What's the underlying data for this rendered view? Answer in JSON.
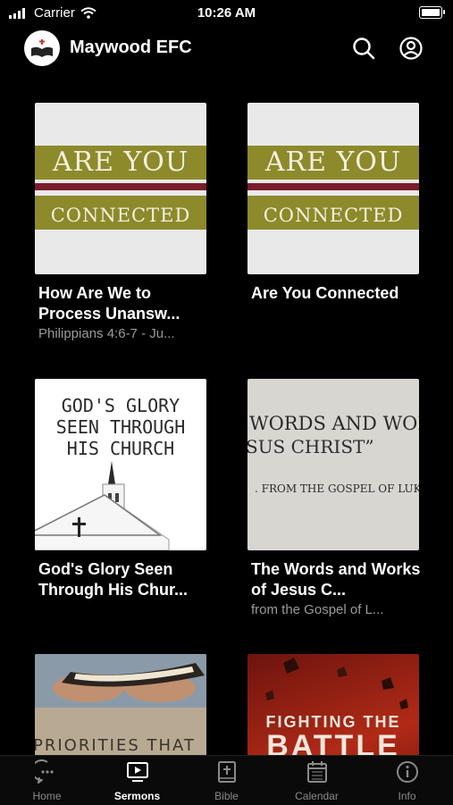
{
  "status_bar": {
    "carrier": "Carrier",
    "time": "10:26 AM"
  },
  "header": {
    "title": "Maywood EFC",
    "logo_icon": "church-bible-logo-icon"
  },
  "sermons": [
    {
      "title": "How Are We to Process Unansw...",
      "subtitle": "Philippians 4:6-7 - Ju...",
      "artwork_text": [
        "ARE YOU",
        "connected"
      ]
    },
    {
      "title": "Are You Connected",
      "subtitle": "",
      "artwork_text": [
        "ARE YOU",
        "connected"
      ]
    },
    {
      "title": "God's Glory Seen Through His Chur...",
      "subtitle": "",
      "artwork_text": [
        "GOD'S GLORY",
        "SEEN THROUGH",
        "HIS CHURCH"
      ]
    },
    {
      "title": "The Words and Works of Jesus C...",
      "subtitle": "from the Gospel of L...",
      "artwork_text": [
        "WORDS AND WORK",
        "SUS CHRIST”",
        ". FROM THE GOSPEL OF LUKE"
      ]
    },
    {
      "title": "",
      "subtitle": "",
      "artwork_text": [
        "PRIORITIES THAT"
      ]
    },
    {
      "title": "",
      "subtitle": "",
      "artwork_text": [
        "FIGHTING THE",
        "BATTLE"
      ]
    }
  ],
  "tabs": [
    {
      "label": "Home",
      "icon": "chat-bubble-icon",
      "active": false
    },
    {
      "label": "Sermons",
      "icon": "tv-play-icon",
      "active": true
    },
    {
      "label": "Bible",
      "icon": "bible-icon",
      "active": false
    },
    {
      "label": "Calendar",
      "icon": "calendar-icon",
      "active": false
    },
    {
      "label": "Info",
      "icon": "info-icon",
      "active": false
    }
  ],
  "colors": {
    "background": "#000000",
    "tab_inactive": "#8a8a8a",
    "tab_active": "#ffffff",
    "subtitle": "#9a9a9a"
  }
}
